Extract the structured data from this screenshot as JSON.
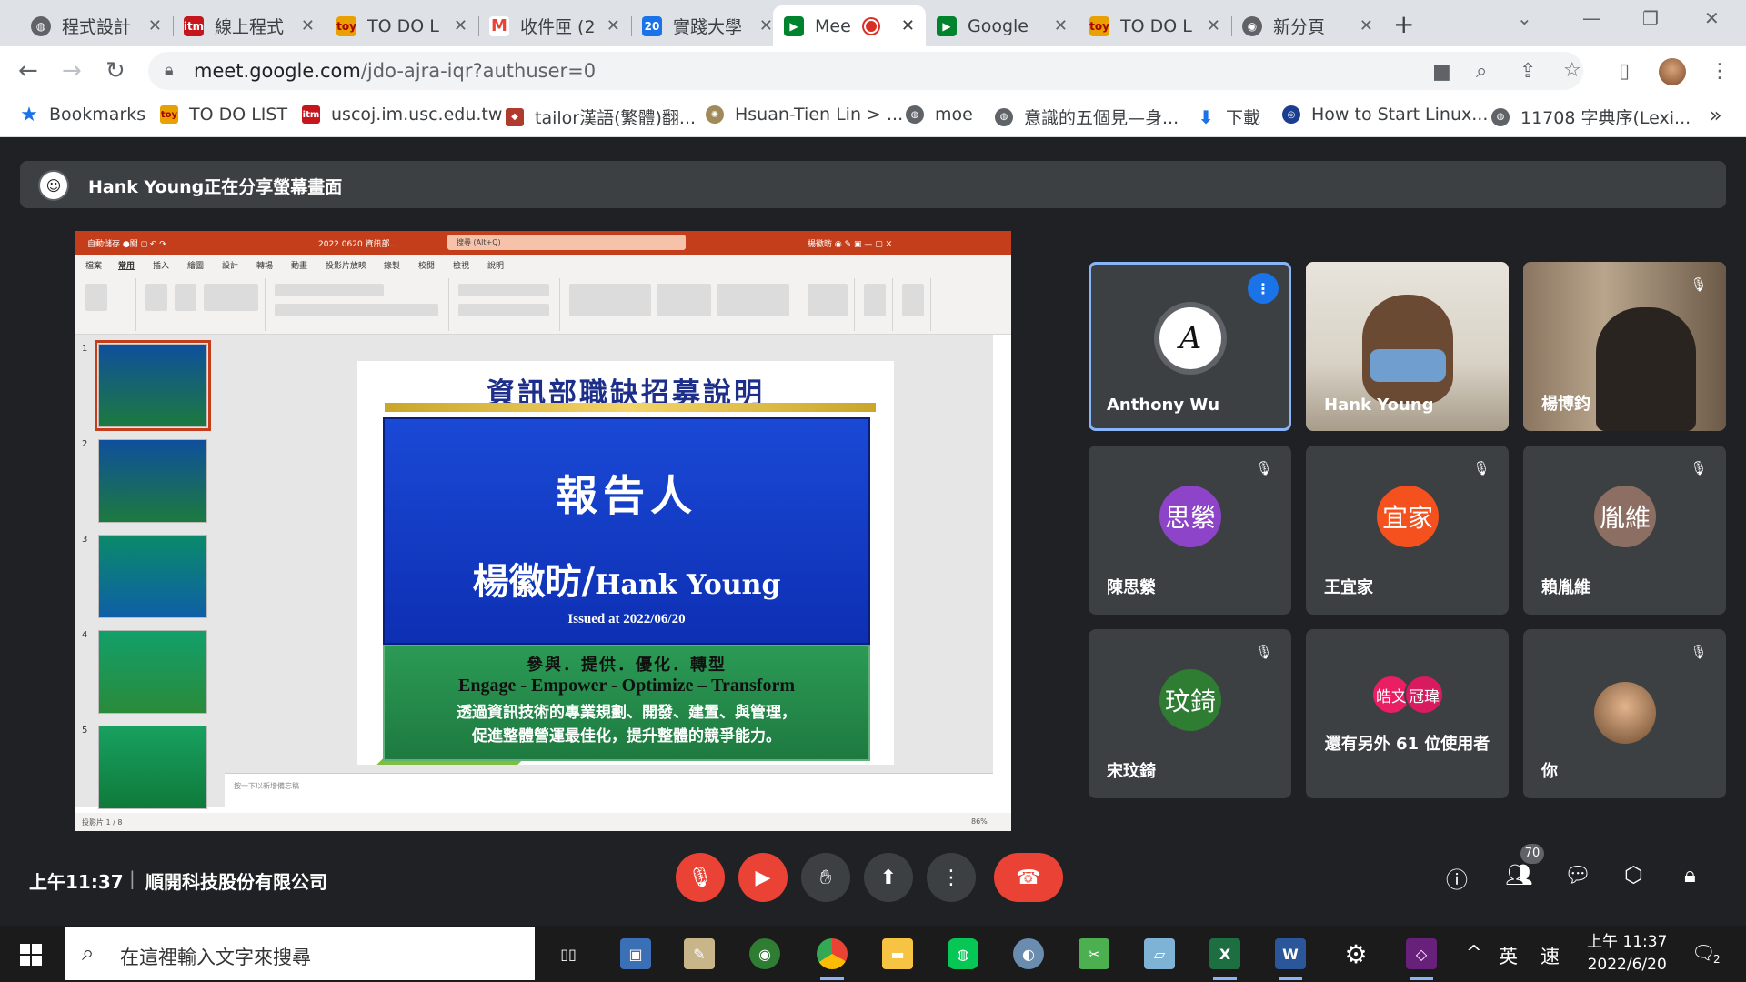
{
  "browser": {
    "tabs": [
      {
        "label": "程式設計",
        "favicon": "globe-icon",
        "color": "#5f6368"
      },
      {
        "label": "線上程式",
        "favicon": "itm-icon",
        "color": "#c4161c"
      },
      {
        "label": "TO DO L",
        "favicon": "todo-icon",
        "color": "#e8a100"
      },
      {
        "label": "收件匣 (2",
        "favicon": "gmail-icon",
        "color": "#ea4335"
      },
      {
        "label": "實踐大學",
        "favicon": "calendar-icon",
        "color": "#1a73e8"
      },
      {
        "label": "Mee",
        "favicon": "meet-icon",
        "color": "#00832d",
        "active": true
      },
      {
        "label": "Google",
        "favicon": "meet-icon",
        "color": "#00832d"
      },
      {
        "label": "TO DO L",
        "favicon": "todo-icon",
        "color": "#e8a100"
      },
      {
        "label": "新分頁",
        "favicon": "chrome-icon",
        "color": "#5f6368"
      }
    ],
    "url_host": "meet.google.com",
    "url_path": "/jdo-ajra-iqr?authuser=0"
  },
  "bookmarks": [
    {
      "label": "Bookmarks",
      "icon": "star-icon"
    },
    {
      "label": "TO DO LIST",
      "icon": "todo-icon"
    },
    {
      "label": "uscoj.im.usc.edu.tw",
      "icon": "itm-icon"
    },
    {
      "label": "tailor漢語(繁體)翻...",
      "icon": "shield-icon"
    },
    {
      "label": "Hsuan-Tien Lin > ...",
      "icon": "seal-icon"
    },
    {
      "label": "moe",
      "icon": "globe-icon"
    },
    {
      "label": "意識的五個見—身...",
      "icon": "globe-icon"
    },
    {
      "label": "下載",
      "icon": "download-icon"
    },
    {
      "label": "How to Start Linux...",
      "icon": "link-icon"
    },
    {
      "label": "11708 字典序(Lexi...",
      "icon": "globe-icon"
    }
  ],
  "meet": {
    "share_banner": "Hank Young正在分享螢幕畫面",
    "time": "上午11:37",
    "meeting_name": "順開科技股份有限公司",
    "participant_count": "70",
    "participants": [
      {
        "name": "Anthony Wu",
        "initial": "A",
        "speaking": true
      },
      {
        "name": "Hank Young",
        "video": true
      },
      {
        "name": "楊博鈞",
        "video": true,
        "muted": true
      },
      {
        "name": "陳思縈",
        "initial": "思縈",
        "color": "#8e44c8",
        "muted": true
      },
      {
        "name": "王宜家",
        "initial": "宜家",
        "color": "#f4511e",
        "muted": true
      },
      {
        "name": "賴胤維",
        "initial": "胤維",
        "color": "#8d6e63",
        "muted": true
      },
      {
        "name": "宋玟錡",
        "initial": "玟錡",
        "color": "#2e7d32",
        "muted": true
      },
      {
        "name": "還有另外 61 位使用者",
        "others": [
          "皓文",
          "冠瑋"
        ],
        "other_colors": [
          "#e91e63",
          "#d81b60"
        ]
      },
      {
        "name": "你",
        "video": true,
        "muted": true
      }
    ]
  },
  "slide": {
    "title": "資訊部職缺招募說明",
    "reporter_label": "報告人",
    "presenter_zh": "楊徽昉/",
    "presenter_en": "Hank Young",
    "issued": "Issued  at  2022/06/20",
    "line1": "參與．提供．優化．轉型",
    "line2": "Engage - Empower - Optimize – Transform",
    "line3": "透過資訊技術的專業規劃、開發、建置、與管理，",
    "line4": "促進整體營運最佳化，提升整體的競爭能力。"
  },
  "powerpoint": {
    "search_placeholder": "搜尋 (Alt+Q)",
    "file_title": "2022 0620 資訊部...",
    "menu": [
      "檔案",
      "常用",
      "插入",
      "繪圖",
      "設計",
      "轉場",
      "動畫",
      "投影片放映",
      "錄製",
      "校閱",
      "檢視",
      "說明"
    ],
    "status_left": "投影片 1 / 8",
    "notes_placeholder": "按一下以新增備忘稿",
    "zoom": "86%"
  },
  "taskbar": {
    "search_placeholder": "在這裡輸入文字來搜尋",
    "ime": "英",
    "time": "上午 11:37",
    "date": "2022/6/20",
    "notification_count": "2"
  }
}
